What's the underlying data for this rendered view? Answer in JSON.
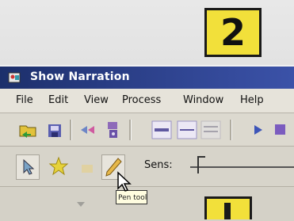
{
  "window": {
    "title": "Show Narration"
  },
  "menubar": {
    "items": [
      "File",
      "Edit",
      "View",
      "Process",
      "Window",
      "Help"
    ]
  },
  "toolbar": {
    "sens_label": "Sens:"
  },
  "tooltip": {
    "text": "Pen tool"
  },
  "callouts": {
    "step_top": "2"
  },
  "colors": {
    "titlebar": "#1c2f6b",
    "callout": "#f2e03a",
    "window_bg": "#d9d6cd"
  },
  "icons": [
    "app-icon",
    "open-folder-icon",
    "save-icon",
    "play-back-icon",
    "record-icon",
    "line-thick-icon",
    "line-medium-icon",
    "line-thin-icon",
    "play-icon",
    "stop-icon",
    "pointer-tool-icon",
    "star-tool-icon",
    "eraser-tool-icon",
    "pen-tool-icon",
    "mouse-cursor-icon"
  ]
}
